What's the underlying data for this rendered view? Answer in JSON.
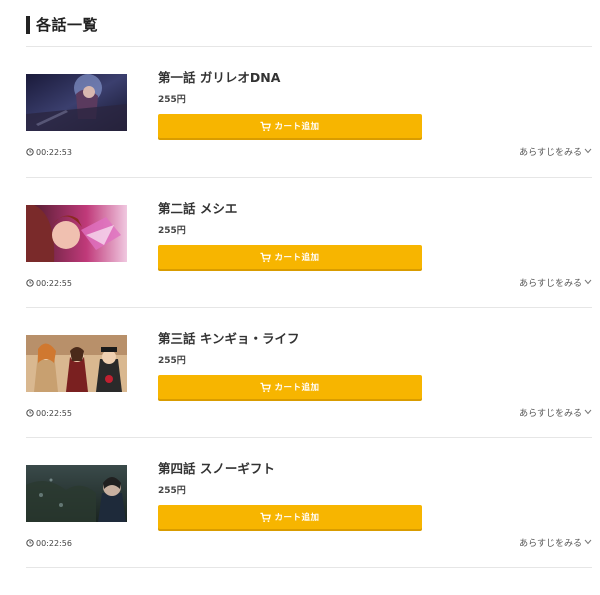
{
  "section": {
    "title": "各話一覧"
  },
  "colors": {
    "accent": "#f7b500",
    "divider": "#e6e6e6"
  },
  "episodes": [
    {
      "title": "第一話 ガリレオDNA",
      "price": "255円",
      "cart_label": "カート追加",
      "duration": "00:22:53",
      "synopsis_label": "あらすじをみる"
    },
    {
      "title": "第二話 メシエ",
      "price": "255円",
      "cart_label": "カート追加",
      "duration": "00:22:55",
      "synopsis_label": "あらすじをみる"
    },
    {
      "title": "第三話 キンギョ・ライフ",
      "price": "255円",
      "cart_label": "カート追加",
      "duration": "00:22:55",
      "synopsis_label": "あらすじをみる"
    },
    {
      "title": "第四話 スノーギフト",
      "price": "255円",
      "cart_label": "カート追加",
      "duration": "00:22:56",
      "synopsis_label": "あらすじをみる"
    }
  ]
}
